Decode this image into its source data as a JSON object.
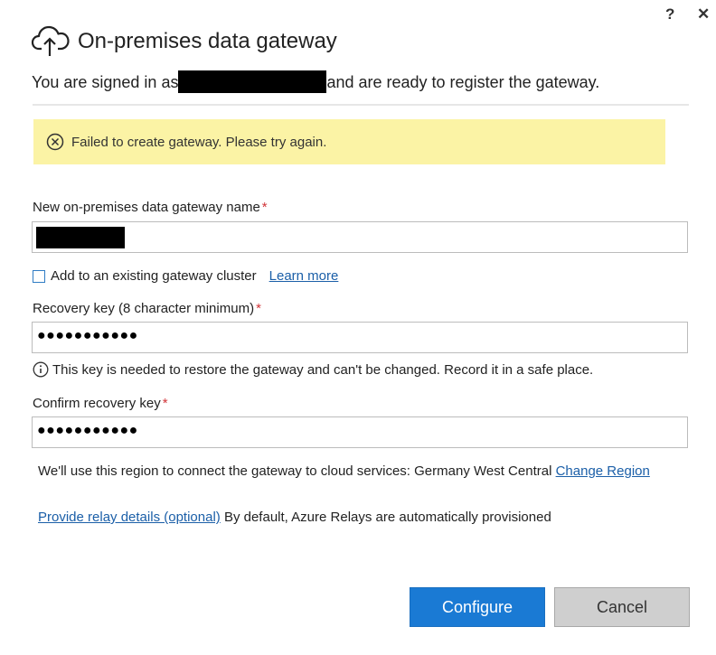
{
  "header": {
    "title": "On-premises data gateway",
    "help_label": "?",
    "close_label": "✕",
    "cloud_icon": "cloud-upload-icon"
  },
  "signin": {
    "prefix": "You are signed in as",
    "suffix": "and are ready to register the gateway."
  },
  "error": {
    "message": "Failed to create gateway. Please try again.",
    "icon": "error-circle-x-icon",
    "background": "#fbf3a5"
  },
  "gateway_name": {
    "label": "New on-premises data gateway name",
    "required_marker": "*"
  },
  "cluster": {
    "checkbox_label": "Add to an existing gateway cluster",
    "checked": false,
    "learn_more": "Learn more"
  },
  "recovery": {
    "label": "Recovery key (8 character minimum)",
    "required_marker": "*",
    "masked_value": "●●●●●●●●●●●",
    "info_text": "This key is needed to restore the gateway and can't be changed. Record it in a safe place.",
    "info_icon": "info-icon"
  },
  "confirm": {
    "label": "Confirm recovery key",
    "required_marker": "*",
    "masked_value": "●●●●●●●●●●●"
  },
  "region": {
    "text": "We'll use this region to connect the gateway to cloud services: Germany West Central",
    "change_link": "Change Region"
  },
  "relay": {
    "link": "Provide relay details (optional)",
    "text": "By default, Azure Relays are automatically provisioned"
  },
  "buttons": {
    "configure": "Configure",
    "cancel": "Cancel"
  },
  "colors": {
    "primary": "#1a7ad4",
    "link": "#1b5fa8",
    "required": "#d13438"
  }
}
